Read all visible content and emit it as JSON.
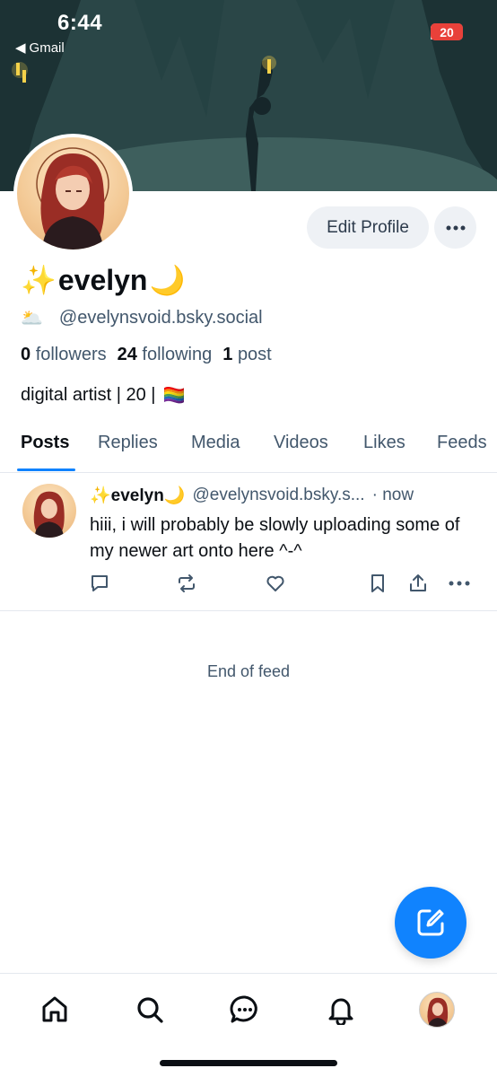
{
  "status_bar": {
    "time": "6:44",
    "back_app": "Gmail",
    "battery_level": "20"
  },
  "profile": {
    "emoji_prefix": "✨",
    "name": "evelyn",
    "emoji_suffix": "🌙",
    "handle_emoji": "🌥️",
    "handle": "@evelynsvoid.bsky.social",
    "edit_label": "Edit Profile",
    "followers_count": "0",
    "followers_label": "followers",
    "following_count": "24",
    "following_label": "following",
    "posts_count": "1",
    "posts_label": "post",
    "bio": "digital artist | 20 |",
    "bio_emoji": "🏳️‍🌈"
  },
  "tabs": [
    "Posts",
    "Replies",
    "Media",
    "Videos",
    "Likes",
    "Feeds"
  ],
  "post": {
    "name": "✨evelyn🌙",
    "handle": "@evelynsvoid.bsky.s...",
    "time": "· now",
    "text": "hiii, i will probably be slowly uploading some of my newer art onto here ^-^"
  },
  "feed_end": "End of feed",
  "colors": {
    "accent": "#1083fe",
    "muted": "#42576c",
    "pill_bg": "#eef1f5"
  },
  "icons": {
    "actions": [
      "reply-icon",
      "repost-icon",
      "like-icon",
      "bookmark-icon",
      "share-icon",
      "more-icon"
    ],
    "nav": [
      "home-icon",
      "search-icon",
      "chat-icon",
      "notifications-icon",
      "profile-avatar"
    ],
    "fab": "compose-icon"
  }
}
